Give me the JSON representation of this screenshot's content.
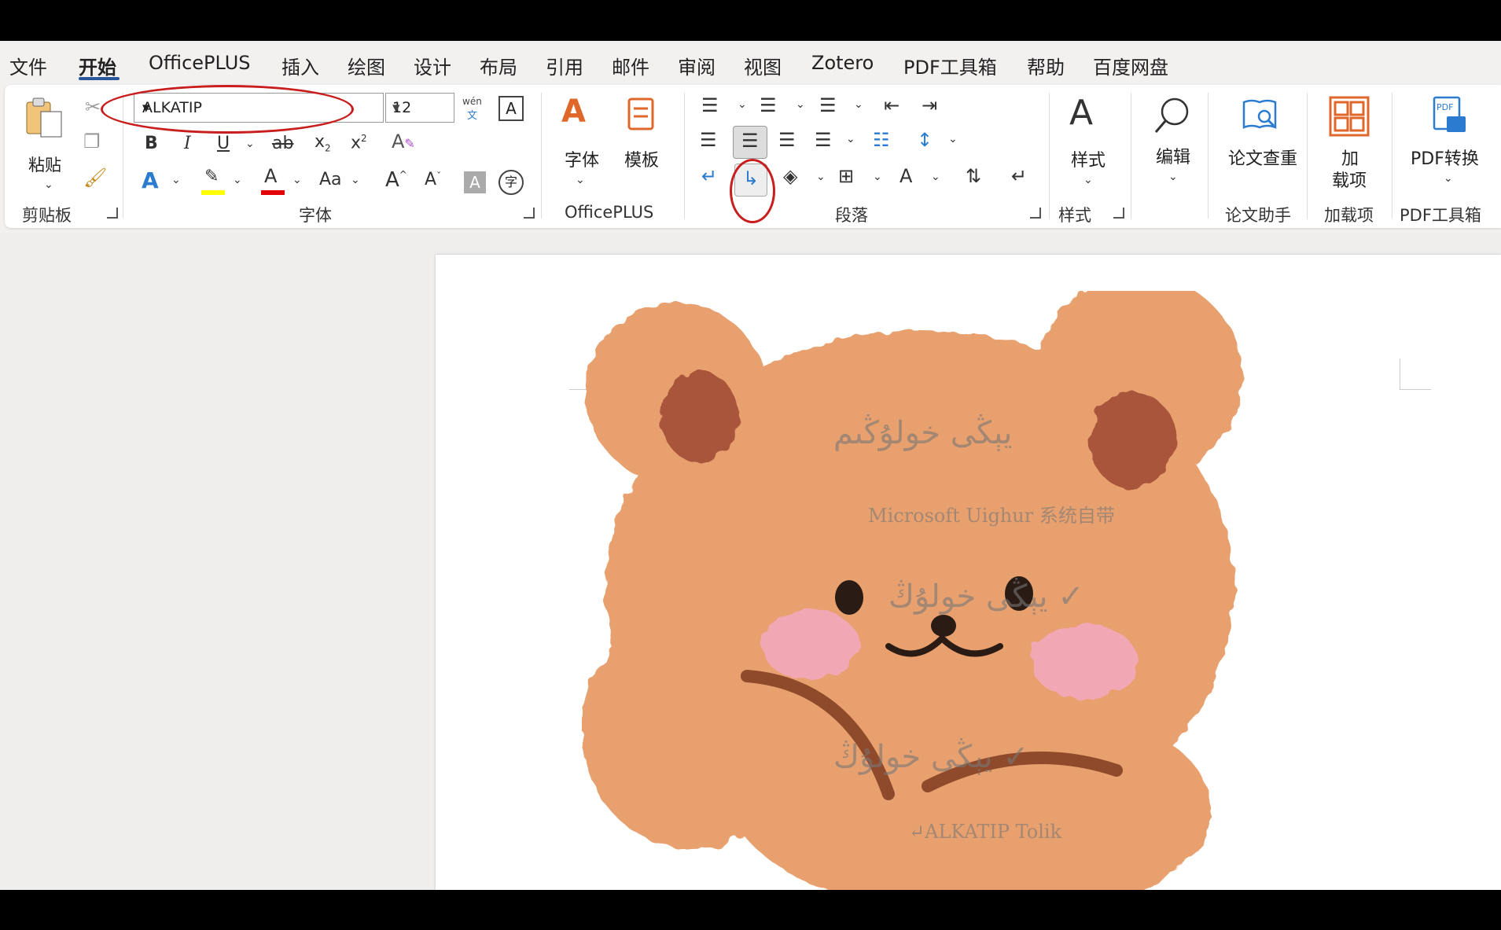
{
  "tabs": [
    "文件",
    "开始",
    "OfficePLUS",
    "插入",
    "绘图",
    "设计",
    "布局",
    "引用",
    "邮件",
    "审阅",
    "视图",
    "Zotero",
    "PDF工具箱",
    "帮助",
    "百度网盘"
  ],
  "active_tab": "开始",
  "clipboard": {
    "paste_label": "粘贴",
    "group_label": "剪贴板"
  },
  "font": {
    "name_value": "ALKATIP",
    "size_value": "12",
    "group_label": "字体",
    "phonetic_top": "wén",
    "phonetic_bottom": "文",
    "bold": "B",
    "italic": "I",
    "underline": "U",
    "strike": "ab",
    "sub": "x",
    "sub_mark": "2",
    "sup": "x",
    "sup_mark": "2",
    "change_case": "Aa",
    "enc_char": "字",
    "highlight_color": "#ffff00",
    "font_color": "#e00000"
  },
  "officeplus": {
    "font_label": "字体",
    "template_label": "模板",
    "group_label": "OfficePLUS"
  },
  "paragraph": {
    "group_label": "段落"
  },
  "styles": {
    "label": "样式",
    "group_label": "样式"
  },
  "editing": {
    "label": "编辑"
  },
  "paper": {
    "check_label": "论文查重",
    "group_label": "论文助手"
  },
  "addins": {
    "label_line1": "加",
    "label_line2": "载项",
    "group_label": "加载项"
  },
  "pdf": {
    "convert_label": "PDF转换",
    "group_label": "PDF工具箱",
    "icon_text": "PDF"
  },
  "document": {
    "line1": "يېڭى خولۇڭىم",
    "line2": "Microsoft Uighur 系统自带",
    "line3": "✓ يېڭى خولۇڭ",
    "line4": "✓ يېڭى خولۇڭ",
    "line5": "↵ALKATIP Tolik"
  },
  "colors": {
    "accent": "#2b579a",
    "annotation_red": "#c81e1e",
    "bear": "#e8a06e"
  }
}
